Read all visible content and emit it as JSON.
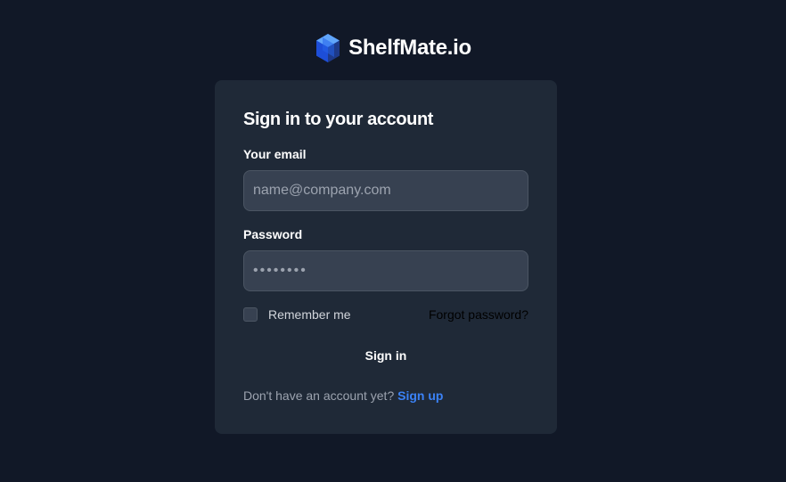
{
  "brand": {
    "name": "ShelfMate.io",
    "logo_icon": "cube-logo-icon"
  },
  "colors": {
    "background": "#111827",
    "card": "#1f2937",
    "input_bg": "#374151",
    "input_border": "#4b5563",
    "link": "#3b82f6"
  },
  "form": {
    "title": "Sign in to your account",
    "email_label": "Your email",
    "email_placeholder": "name@company.com",
    "email_value": "",
    "password_label": "Password",
    "password_placeholder": "••••••••",
    "password_value": "",
    "remember_label": "Remember me",
    "remember_checked": false,
    "forgot_label": "Forgot password?",
    "submit_label": "Sign in",
    "signup_prompt": "Don't have an account yet?",
    "signup_label": "Sign up"
  }
}
